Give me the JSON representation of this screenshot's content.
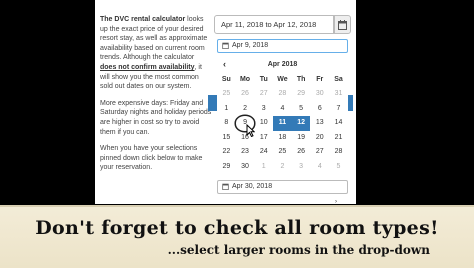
{
  "description": {
    "p1_title": "The DVC rental calculator",
    "p1_text_a": "looks up the exact price of your desired resort stay, as well as approximate availability based on current room trends. Although the calculator",
    "p1_link": "does not confirm availability",
    "p1_text_b": ", it will show you the most common sold out dates on our system.",
    "p2": "More expensive days: Friday and Saturday nights and holiday periods are higher in cost so try to avoid them if you can.",
    "p3": "When you have your selections pinned down click below to make your reservation."
  },
  "date_range": {
    "value": "Apr 11, 2018 to Apr 12, 2018",
    "icon": "calendar-icon"
  },
  "checkin": {
    "value": "Apr 9, 2018",
    "icon": "calendar-icon"
  },
  "checkout": {
    "value": "Apr 30, 2018",
    "icon": "calendar-icon"
  },
  "calendar": {
    "month_label": "Apr 2018",
    "prev_icon": "chevron-left-icon",
    "weekdays": [
      "Su",
      "Mo",
      "Tu",
      "We",
      "Th",
      "Fr",
      "Sa"
    ],
    "weeks": [
      [
        "25",
        "26",
        "27",
        "28",
        "29",
        "30",
        "31"
      ],
      [
        "1",
        "2",
        "3",
        "4",
        "5",
        "6",
        "7"
      ],
      [
        "8",
        "9",
        "10",
        "11",
        "12",
        "13",
        "14"
      ],
      [
        "15",
        "16",
        "17",
        "18",
        "19",
        "20",
        "21"
      ],
      [
        "22",
        "23",
        "24",
        "25",
        "26",
        "27",
        "28"
      ],
      [
        "29",
        "30",
        "1",
        "2",
        "3",
        "4",
        "5"
      ]
    ],
    "selected": [
      "11",
      "12"
    ],
    "hovered": "9"
  },
  "banner": {
    "main": "Don't forget to check all room types!",
    "sub": "...select larger rooms in the drop-down"
  },
  "colors": {
    "accent": "#337ab7",
    "banner_bg": "#efe7cf"
  }
}
